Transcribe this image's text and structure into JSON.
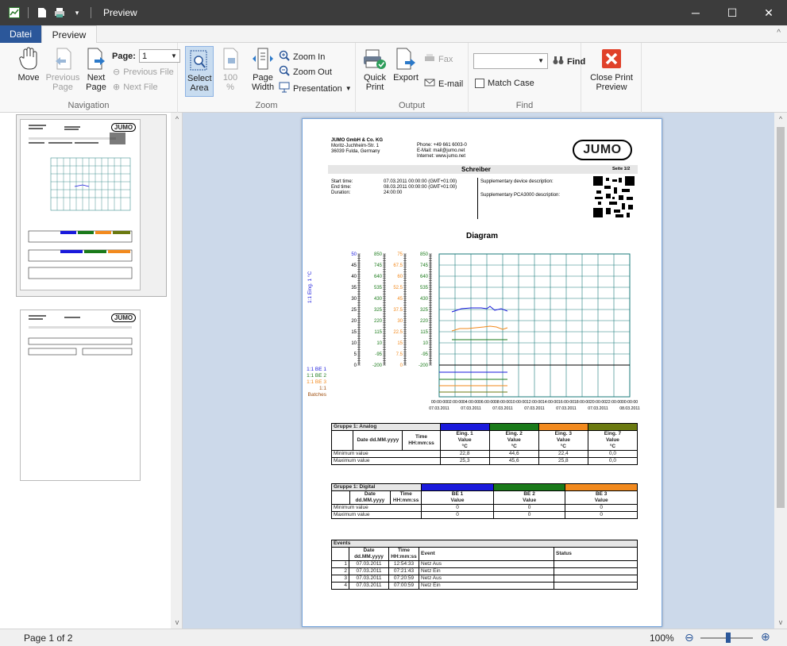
{
  "window": {
    "title": "Preview",
    "controls": {
      "minimize": "─",
      "maximize": "☐",
      "close": "✕"
    }
  },
  "ribbon_tabs": {
    "file": "Datei",
    "preview": "Preview"
  },
  "ribbon": {
    "navigation": {
      "label": "Navigation",
      "move": "Move",
      "previous_page": "Previous Page",
      "next_page": "Next Page",
      "page_label": "Page:",
      "page_value": "1",
      "previous_file": "Previous File",
      "next_file": "Next File"
    },
    "zoom": {
      "label": "Zoom",
      "select_area": "Select Area",
      "hundred_pct": "100 %",
      "page_width": "Page Width",
      "zoom_in": "Zoom In",
      "zoom_out": "Zoom Out",
      "presentation": "Presentation"
    },
    "output": {
      "label": "Output",
      "quick_print": "Quick Print",
      "export": "Export",
      "fax": "Fax",
      "email": "E-mail"
    },
    "find": {
      "label": "Find",
      "find_button": "Find",
      "match_case": "Match Case",
      "search_value": ""
    },
    "close_print_preview": "Close Print Preview"
  },
  "status": {
    "page_info": "Page 1 of 2",
    "zoom": "100%"
  },
  "report": {
    "company": [
      "JUMO GmbH & Co. KG",
      "Moritz-Juchheim-Str. 1",
      "36039 Fulda, Germany"
    ],
    "contact": [
      "Phone:  +49 661 6003-0",
      "E-Mail:   mail@jumo.net",
      "Internet:  www.jumo.net"
    ],
    "logo": "JUMO",
    "section_title": "Schreiber",
    "page_no": "Seite 1/2",
    "time_labels": [
      "Start time:",
      "End time:",
      "Duration:"
    ],
    "time_values": [
      "07.03.2011 00:00:00 (GMT+01:00)",
      "08.03.2011 00:00:00 (GMT+01:00)",
      "24:00:00"
    ],
    "supp_device": "Supplementary device description:",
    "supp_pca": "Supplementary PCA3000 description:",
    "diagram_title": "Diagram",
    "y_label": "1:1  Eing. 1  °C",
    "y_ticks": [
      "50",
      "45",
      "40",
      "35",
      "30",
      "25",
      "20",
      "15",
      "10",
      "5",
      "0"
    ],
    "y_ticks_2": [
      "850",
      "745",
      "640",
      "535",
      "430",
      "325",
      "220",
      "115",
      "10",
      "-95",
      "-200"
    ],
    "y_ticks_3": [
      "75",
      "67.5",
      "60",
      "52.5",
      "45",
      "37.5",
      "30",
      "22.5",
      "15",
      "7.5",
      "0"
    ],
    "y_ticks_4": [
      "850",
      "745",
      "640",
      "535",
      "430",
      "325",
      "220",
      "115",
      "10",
      "-95",
      "-200"
    ],
    "digital_labels": [
      "1:1  BE 1",
      "1:1  BE 2",
      "1:1  BE 3",
      "1:1  Batches"
    ],
    "x_ticks": [
      "00:00:00",
      "02:00:00",
      "04:00:00",
      "06:00:00",
      "08:00:00",
      "10:00:00",
      "12:00:00",
      "14:00:00",
      "16:00:00",
      "18:00:00",
      "20:00:00",
      "22:00:00",
      "00:00:00"
    ],
    "x_dates": [
      "07.03.2011",
      "07.03.2011",
      "07.03.2011",
      "07.03.2011",
      "07.03.2011",
      "07.03.2011",
      "08.03.2011"
    ],
    "analog_table": {
      "title": "Gruppe 1: Analog",
      "col_date": "Date dd.MM.yyyy",
      "col_time": "Time HH:mm:ss",
      "channels": [
        {
          "name": "Eing. 1",
          "sub": "Value",
          "unit": "°C",
          "color": "#1a1adc",
          "min": "22,8",
          "max": "25,3"
        },
        {
          "name": "Eing. 2",
          "sub": "Value",
          "unit": "°C",
          "color": "#1a7a1a",
          "min": "44,6",
          "max": "45,6"
        },
        {
          "name": "Eing. 3",
          "sub": "Value",
          "unit": "°C",
          "color": "#f28a1e",
          "min": "22,4",
          "max": "25,8"
        },
        {
          "name": "Eing. 7",
          "sub": "Value",
          "unit": "°C",
          "color": "#6b7a10",
          "min": "0,0",
          "max": "0,0"
        }
      ],
      "row_min": "Minimum value",
      "row_max": "Maximum value"
    },
    "digital_table": {
      "title": "Gruppe 1: Digital",
      "channels": [
        {
          "name": "BE 1",
          "sub": "Value",
          "color": "#1a1adc",
          "min": "0",
          "max": "0"
        },
        {
          "name": "BE 2",
          "sub": "Value",
          "color": "#1a7a1a",
          "min": "0",
          "max": "0"
        },
        {
          "name": "BE 3",
          "sub": "Value",
          "color": "#f28a1e",
          "min": "0",
          "max": "0"
        }
      ]
    },
    "events_table": {
      "title": "Events",
      "col_event": "Event",
      "col_status": "Status",
      "rows": [
        {
          "n": "1",
          "date": "07.03.2011",
          "time": "12:54:33",
          "event": "Netz Aus"
        },
        {
          "n": "2",
          "date": "07.03.2011",
          "time": "07:21:43",
          "event": "Netz Ein"
        },
        {
          "n": "3",
          "date": "07.03.2011",
          "time": "07:20:59",
          "event": "Netz Aus"
        },
        {
          "n": "4",
          "date": "07.03.2011",
          "time": "07:00:59",
          "event": "Netz Ein"
        }
      ]
    }
  }
}
